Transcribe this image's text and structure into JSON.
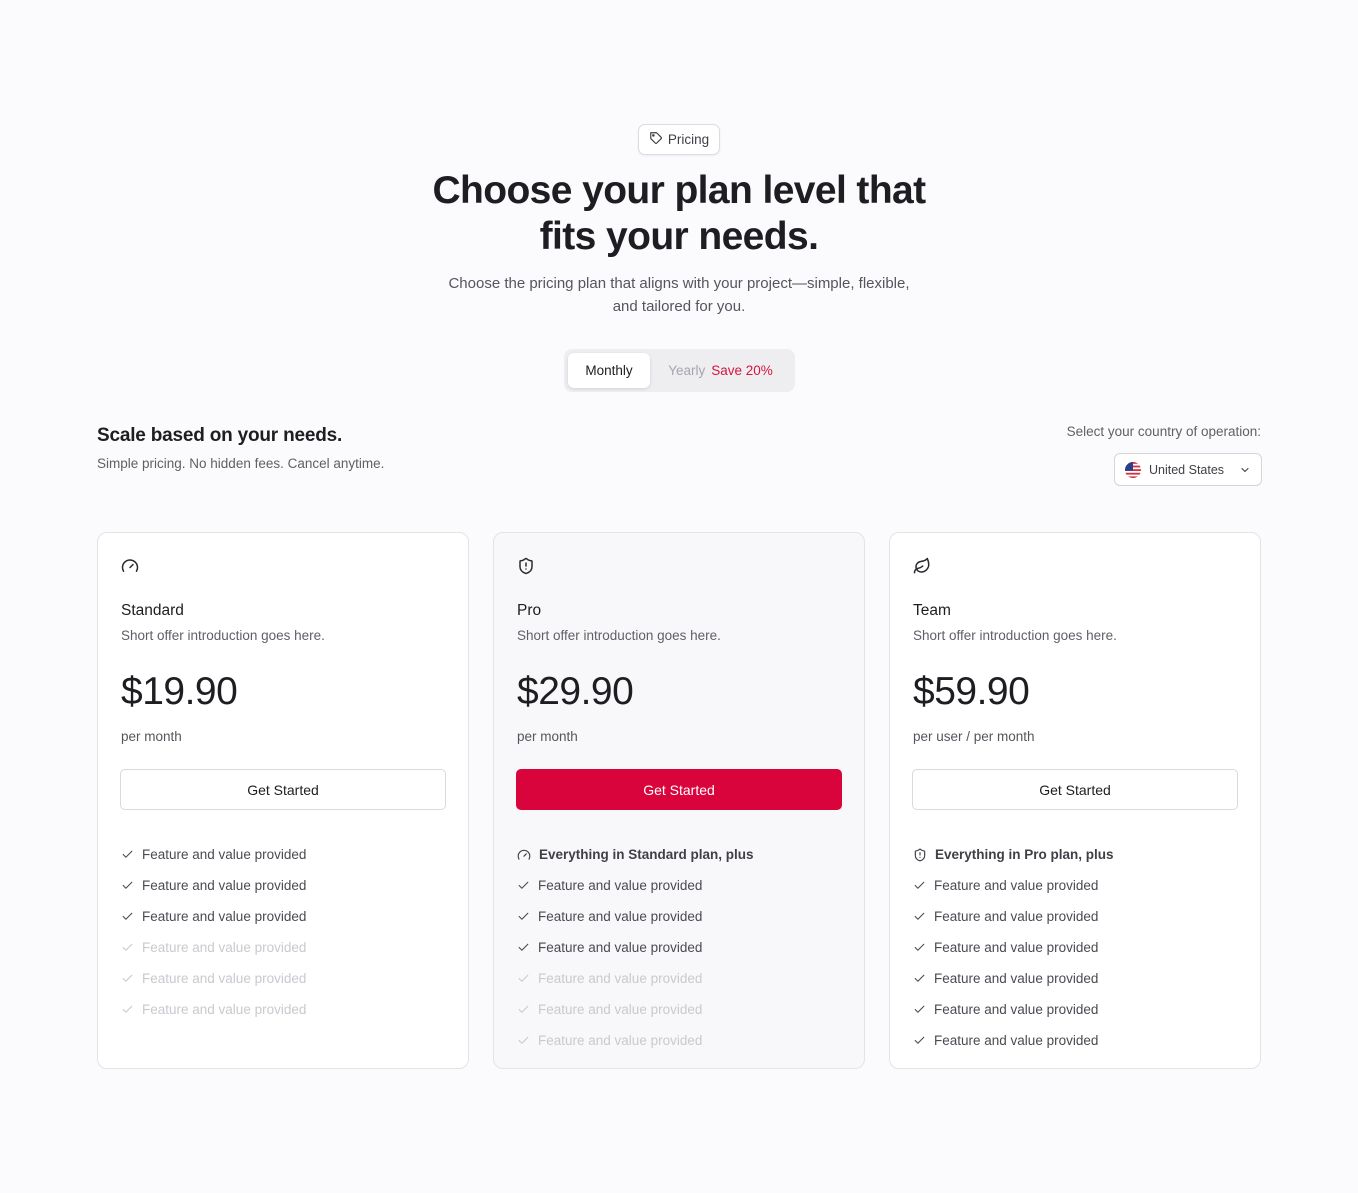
{
  "header": {
    "badge_label": "Pricing",
    "title_line1": "Choose your plan level that",
    "title_line2": "fits your needs.",
    "subtitle_line1": "Choose the pricing plan that aligns with your project—simple, flexible,",
    "subtitle_line2": "and tailored for you."
  },
  "billing_toggle": {
    "monthly_label": "Monthly",
    "yearly_label": "Yearly",
    "yearly_save_label": "Save 20%",
    "selected": "Monthly"
  },
  "section": {
    "title": "Scale based on your needs.",
    "subtitle": "Simple pricing. No hidden fees. Cancel anytime."
  },
  "country": {
    "label": "Select your country of operation:",
    "selected": "United States"
  },
  "plans": [
    {
      "icon": "gauge-icon",
      "name": "Standard",
      "intro": "Short offer introduction goes here.",
      "price": "$19.90",
      "unit": "per month",
      "cta": "Get Started",
      "features": [
        {
          "text": "Feature and value provided",
          "included": true
        },
        {
          "text": "Feature and value provided",
          "included": true
        },
        {
          "text": "Feature and value provided",
          "included": true
        },
        {
          "text": "Feature and value provided",
          "included": false
        },
        {
          "text": "Feature and value provided",
          "included": false
        },
        {
          "text": "Feature and value provided",
          "included": false
        }
      ]
    },
    {
      "icon": "shield-icon",
      "name": "Pro",
      "intro": "Short offer introduction goes here.",
      "price": "$29.90",
      "unit": "per month",
      "cta": "Get Started",
      "features_heading": "Everything in Standard plan, plus",
      "features": [
        {
          "text": "Feature and value provided",
          "included": true
        },
        {
          "text": "Feature and value provided",
          "included": true
        },
        {
          "text": "Feature and value provided",
          "included": true
        },
        {
          "text": "Feature and value provided",
          "included": false
        },
        {
          "text": "Feature and value provided",
          "included": false
        },
        {
          "text": "Feature and value provided",
          "included": false
        }
      ]
    },
    {
      "icon": "leaf-icon",
      "name": "Team",
      "intro": "Short offer introduction goes here.",
      "price": "$59.90",
      "unit": "per user / per month",
      "cta": "Get Started",
      "features_heading": "Everything in Pro plan, plus",
      "features": [
        {
          "text": "Feature and value provided",
          "included": true
        },
        {
          "text": "Feature and value provided",
          "included": true
        },
        {
          "text": "Feature and value provided",
          "included": true
        },
        {
          "text": "Feature and value provided",
          "included": true
        },
        {
          "text": "Feature and value provided",
          "included": true
        },
        {
          "text": "Feature and value provided",
          "included": true
        }
      ]
    }
  ],
  "colors": {
    "accent": "#d9043b",
    "background": "#fbfafc",
    "text": "#1d1d22"
  }
}
